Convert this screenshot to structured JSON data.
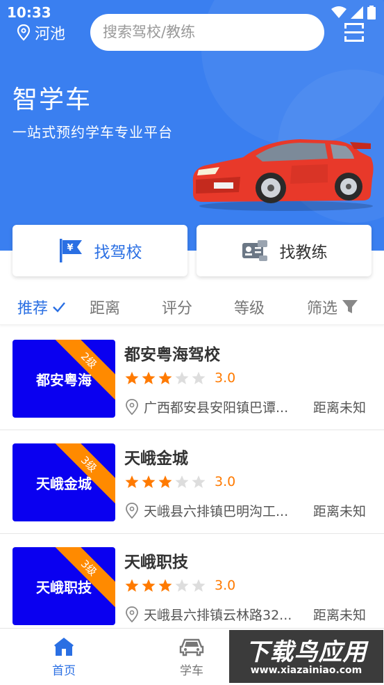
{
  "status_bar": {
    "time": "10:33"
  },
  "header": {
    "location": "河池",
    "search_placeholder": "搜索驾校/教练"
  },
  "hero": {
    "title": "智学车",
    "subtitle": "一站式预约学车专业平台"
  },
  "actions": {
    "find_school": "找驾校",
    "find_coach": "找教练"
  },
  "filters": {
    "recommend": "推荐",
    "distance": "距离",
    "score": "评分",
    "level": "等级",
    "filter": "筛选"
  },
  "schools": [
    {
      "thumb_name": "都安粤海",
      "level": "2级",
      "name": "都安粤海驾校",
      "rating": "3.0",
      "stars": 3,
      "address": "广西都安县安阳镇巴谭...",
      "distance": "距离未知"
    },
    {
      "thumb_name": "天峨金城",
      "level": "3级",
      "name": "天峨金城",
      "rating": "3.0",
      "stars": 3,
      "address": "天峨县六排镇巴明沟工...",
      "distance": "距离未知"
    },
    {
      "thumb_name": "天峨职技",
      "level": "3级",
      "name": "天峨职技",
      "rating": "3.0",
      "stars": 3,
      "address": "天峨县六排镇云林路32...",
      "distance": "距离未知"
    }
  ],
  "bottom_nav": {
    "home": "首页",
    "learn": "学车"
  },
  "watermark": {
    "brand": "下载鸟应用",
    "url": "www.xiazainiao.com"
  },
  "colors": {
    "primary": "#3a7ff0",
    "thumb_bg": "#0a00f0",
    "ribbon": "#ff8a00",
    "star_on": "#ff7a00",
    "star_off": "#dddddd"
  }
}
